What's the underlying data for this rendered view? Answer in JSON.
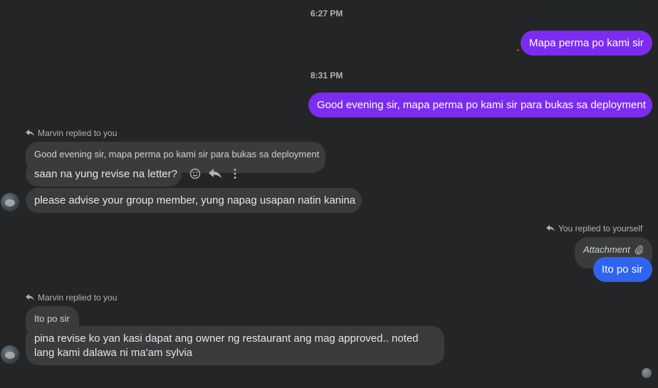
{
  "timestamps": {
    "first": "6:27 PM",
    "second": "8:31 PM"
  },
  "messages": {
    "out1": "Mapa perma po kami sir",
    "out2": "Good evening sir, mapa perma po kami sir para bukas sa deployment",
    "reply1_meta": "Marvin replied to you",
    "reply1_quoted": "Good evening sir, mapa perma po kami sir para bukas sa deployment",
    "in1": "saan na yung revise na letter?",
    "in2": "please advise your group member, yung napag usapan natin kanina",
    "reply2_meta": "You replied to yourself",
    "reply2_quoted": "Attachment",
    "out3": "Ito po sir",
    "reply3_meta": "Marvin replied to you",
    "reply3_quoted": "Ito po sir",
    "in3_line1": "pina revise ko yan kasi dapat ang owner ng restaurant ang mag approved.. noted",
    "in3_line2": "lang kami dalawa ni ma'am sylvia"
  },
  "colors": {
    "background": "#242526",
    "outgoing_purple": "#7b2cf0",
    "outgoing_blue": "#2e64f0",
    "incoming": "#3a3b3c"
  },
  "icons": {
    "reply": "reply-arrow-icon",
    "react": "smiley-icon",
    "more": "more-vertical-icon",
    "attachment": "paperclip-icon",
    "seen": "seen-avatar-icon"
  }
}
